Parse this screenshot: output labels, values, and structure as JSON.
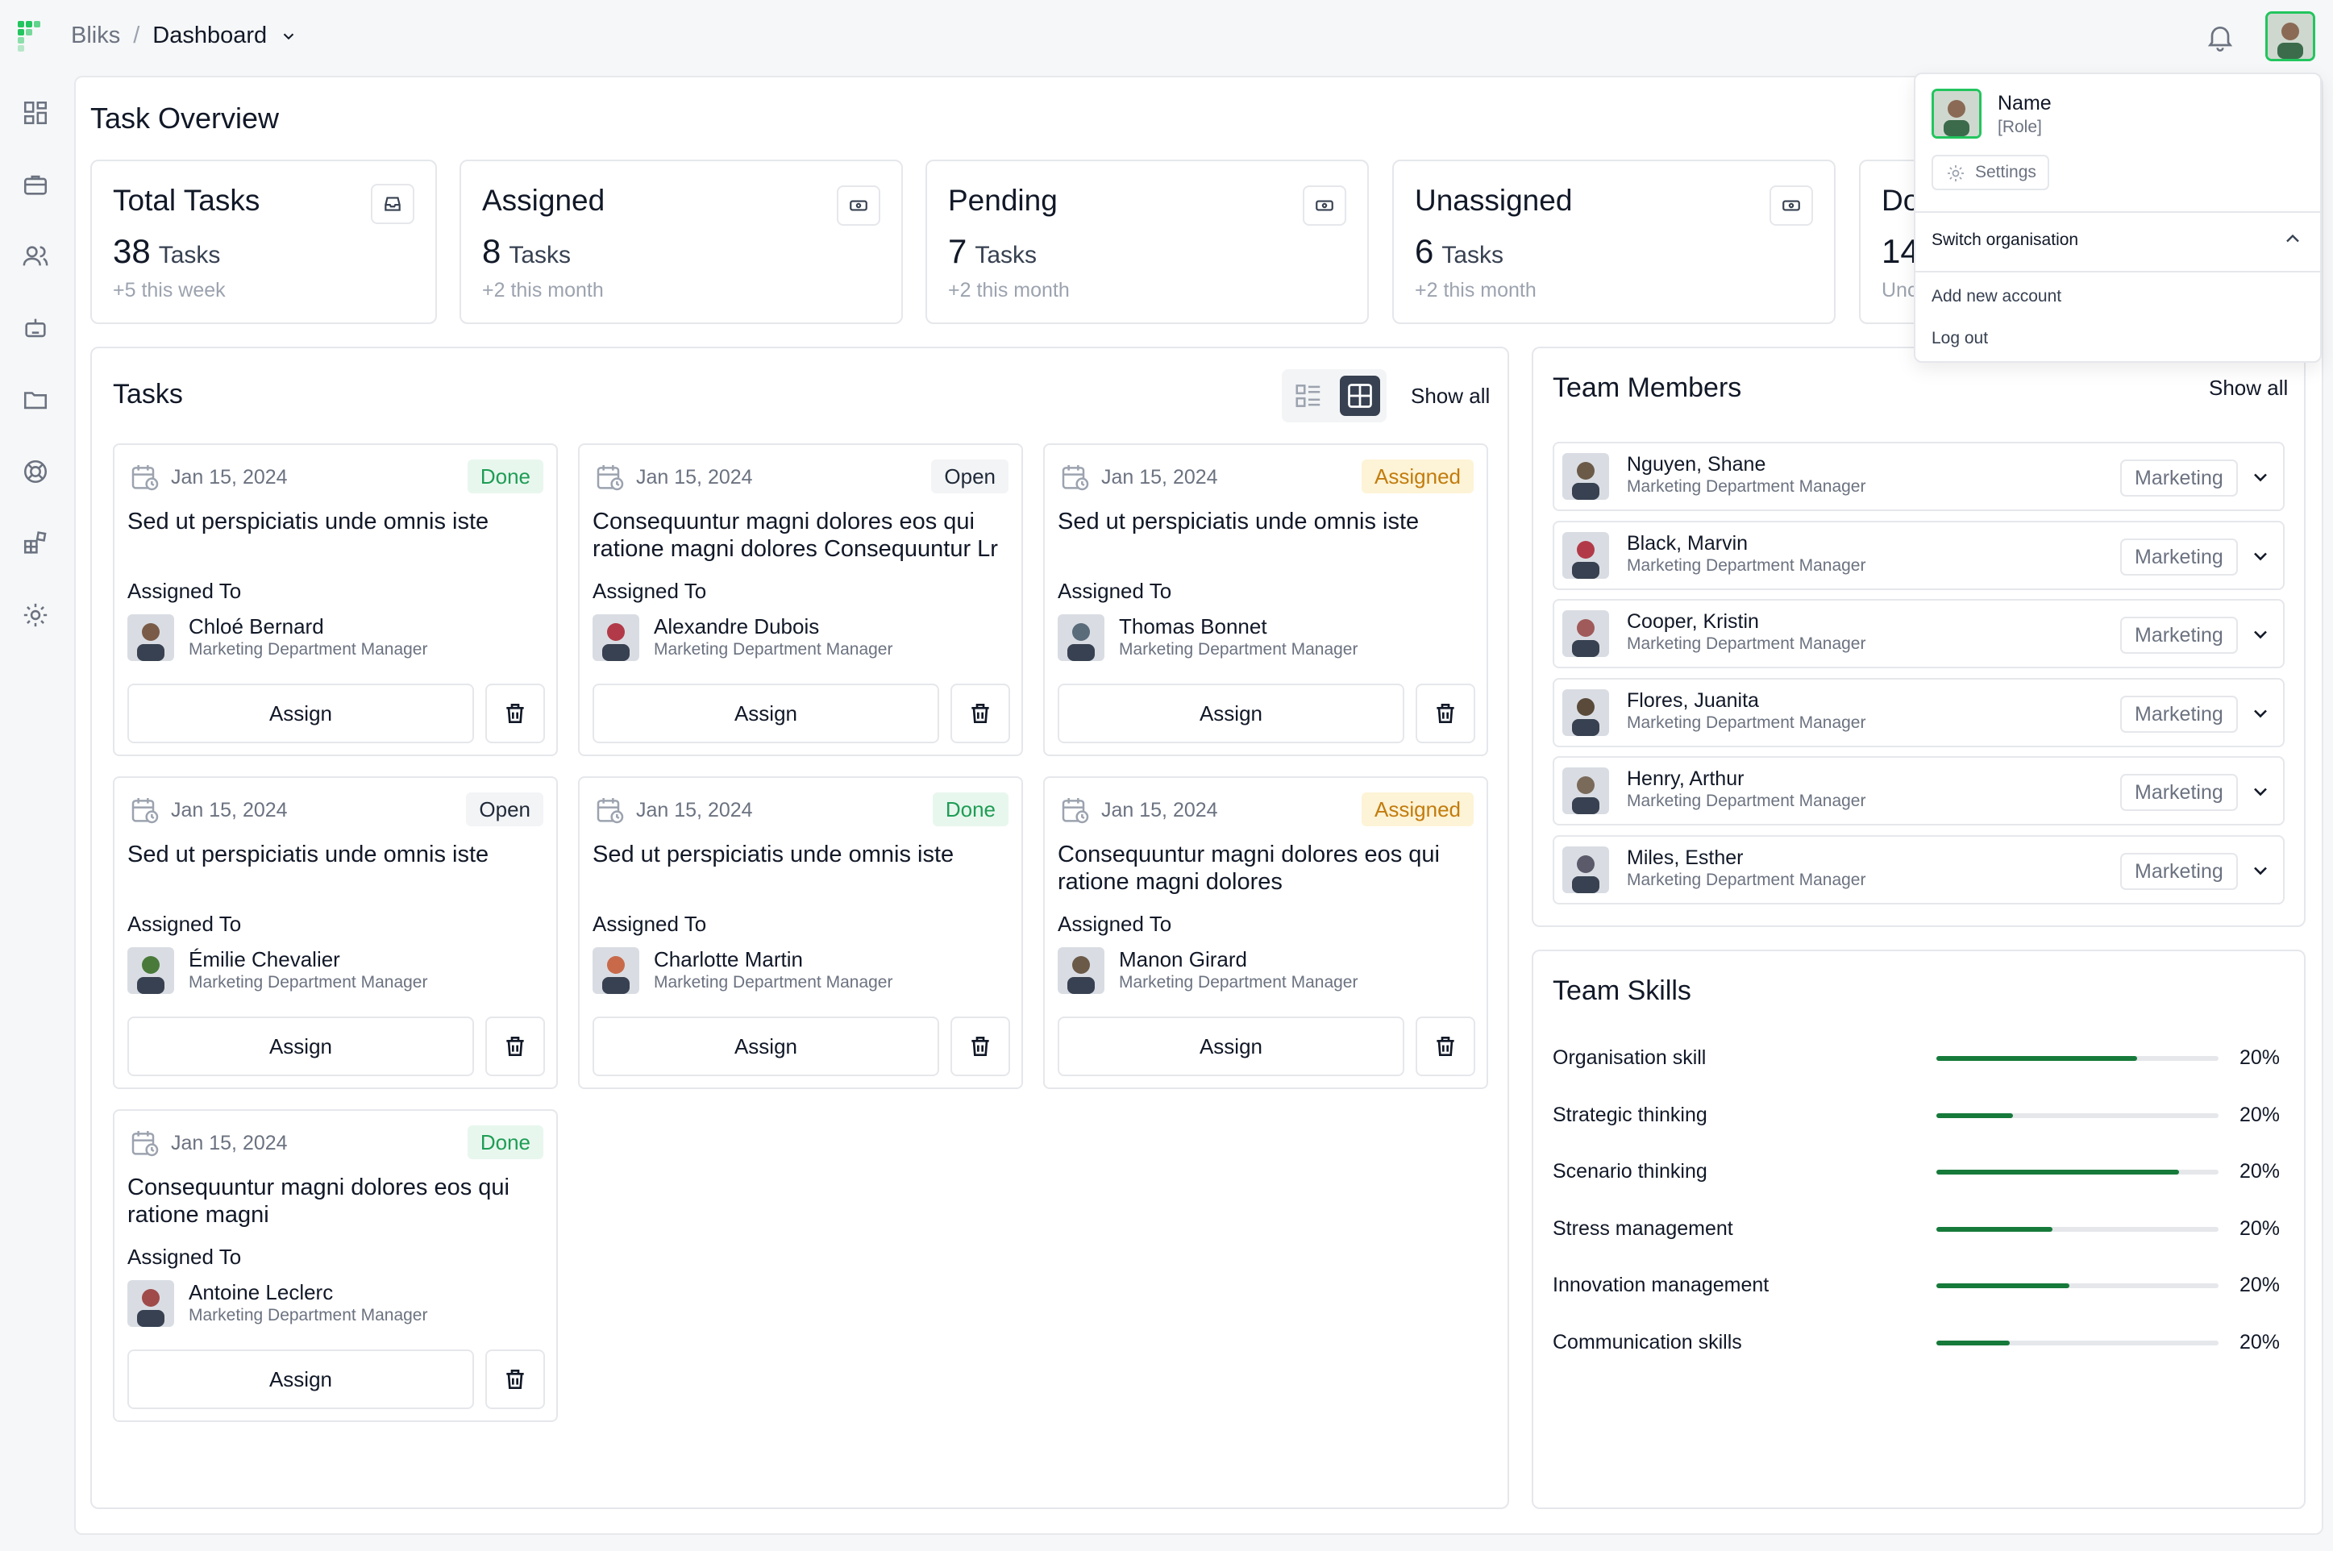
{
  "header": {
    "brand": "Bliks",
    "separator": "/",
    "page": "Dashboard"
  },
  "page_title": "Task Overview",
  "stats": [
    {
      "title": "Total Tasks",
      "count": "38",
      "unit": "Tasks",
      "sub": "+5 this week"
    },
    {
      "title": "Assigned",
      "count": "8",
      "unit": "Tasks",
      "sub": "+2 this month"
    },
    {
      "title": "Pending",
      "count": "7",
      "unit": "Tasks",
      "sub": "+2 this month"
    },
    {
      "title": "Unassigned",
      "count": "6",
      "unit": "Tasks",
      "sub": "+2 this month"
    },
    {
      "title": "Do",
      "count": "14",
      "unit": "",
      "sub": "Unc"
    }
  ],
  "tasks_panel": {
    "title": "Tasks",
    "show_all": "Show all",
    "assigned_to_label": "Assigned To",
    "assign_label": "Assign"
  },
  "tasks": [
    {
      "date": "Jan 15, 2024",
      "status": "Done",
      "title": "Sed ut perspiciatis unde omnis iste",
      "assignee": "Chloé Bernard",
      "role": "Marketing Department Manager"
    },
    {
      "date": "Jan 15, 2024",
      "status": "Open",
      "title": "Consequuntur magni dolores eos qui ratione magni dolores Consequuntur Lr",
      "assignee": "Alexandre Dubois",
      "role": "Marketing Department Manager"
    },
    {
      "date": "Jan 15, 2024",
      "status": "Assigned",
      "title": "Sed ut perspiciatis unde omnis iste",
      "assignee": "Thomas Bonnet",
      "role": "Marketing Department Manager"
    },
    {
      "date": "Jan 15, 2024",
      "status": "Open",
      "title": "Sed ut perspiciatis unde omnis iste",
      "assignee": "Émilie Chevalier",
      "role": "Marketing Department Manager"
    },
    {
      "date": "Jan 15, 2024",
      "status": "Done",
      "title": "Sed ut perspiciatis unde omnis iste",
      "assignee": "Charlotte Martin",
      "role": "Marketing Department Manager"
    },
    {
      "date": "Jan 15, 2024",
      "status": "Assigned",
      "title": "Consequuntur magni dolores eos qui ratione magni dolores",
      "assignee": "Manon Girard",
      "role": "Marketing Department Manager"
    },
    {
      "date": "Jan 15, 2024",
      "status": "Done",
      "title": "Consequuntur magni dolores eos qui ratione magni",
      "assignee": "Antoine Leclerc",
      "role": "Marketing Department Manager"
    }
  ],
  "team_panel": {
    "title": "Team Members",
    "show_all": "Show all"
  },
  "members": [
    {
      "name": "Nguyen, Shane",
      "role": "Marketing Department Manager",
      "tag": "Marketing"
    },
    {
      "name": "Black, Marvin",
      "role": "Marketing Department Manager",
      "tag": "Marketing"
    },
    {
      "name": "Cooper, Kristin",
      "role": "Marketing Department Manager",
      "tag": "Marketing"
    },
    {
      "name": "Flores, Juanita",
      "role": "Marketing Department Manager",
      "tag": "Marketing"
    },
    {
      "name": "Henry, Arthur",
      "role": "Marketing Department Manager",
      "tag": "Marketing"
    },
    {
      "name": "Miles, Esther",
      "role": "Marketing Department Manager",
      "tag": "Marketing"
    }
  ],
  "skills_panel": {
    "title": "Team Skills"
  },
  "skills": [
    {
      "label": "Organisation skill",
      "pct": "20%",
      "level": 0.71
    },
    {
      "label": "Strategic thinking",
      "pct": "20%",
      "level": 0.27
    },
    {
      "label": "Scenario thinking",
      "pct": "20%",
      "level": 0.86
    },
    {
      "label": "Stress management",
      "pct": "20%",
      "level": 0.41
    },
    {
      "label": "Innovation management",
      "pct": "20%",
      "level": 0.47
    },
    {
      "label": "Communication skills",
      "pct": "20%",
      "level": 0.26
    }
  ],
  "profile_menu": {
    "name": "Name",
    "role": "[Role]",
    "settings": "Settings",
    "switch_org": "Switch organisation",
    "add_account": "Add new account",
    "logout": "Log out"
  },
  "colors": {
    "accent_green": "#22c55e",
    "skill_bar": "#167a3a",
    "done": "#1f9d55",
    "assigned": "#c27c0e"
  },
  "sidebar_icons": [
    "dashboard-icon",
    "briefcase-icon",
    "users-icon",
    "robot-icon",
    "folder-icon",
    "support-icon",
    "apps-icon",
    "gear-icon"
  ]
}
